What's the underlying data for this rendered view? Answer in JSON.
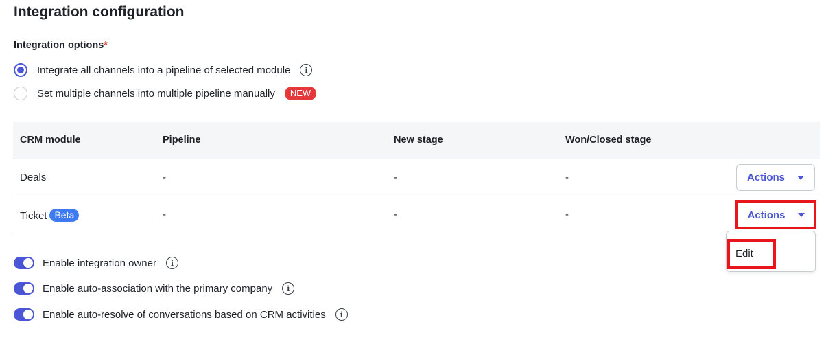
{
  "title": "Integration configuration",
  "options_label": "Integration options",
  "required_mark": "*",
  "radio_options": [
    {
      "label": "Integrate all channels into a pipeline of selected module",
      "checked": true
    },
    {
      "label": "Set multiple channels into multiple pipeline manually",
      "checked": false,
      "badge": "NEW"
    }
  ],
  "table": {
    "headers": [
      "CRM module",
      "Pipeline",
      "New stage",
      "Won/Closed stage"
    ],
    "rows": [
      {
        "module": "Deals",
        "badge": "",
        "pipeline": "-",
        "new_stage": "-",
        "won_stage": "-",
        "action": "Actions"
      },
      {
        "module": "Ticket",
        "badge": "Beta",
        "pipeline": "-",
        "new_stage": "-",
        "won_stage": "-",
        "action": "Actions"
      }
    ]
  },
  "dropdown": {
    "items": [
      "Edit"
    ]
  },
  "toggles": [
    {
      "label": "Enable integration owner",
      "on": true
    },
    {
      "label": "Enable auto-association with the primary company",
      "on": true
    },
    {
      "label": "Enable auto-resolve of conversations based on CRM activities",
      "on": true
    }
  ],
  "colors": {
    "accent": "#4a56d6",
    "danger": "#e5383b",
    "beta": "#3e7bf2",
    "highlight": "#e8161c"
  },
  "icons": {
    "info": "info-icon",
    "caret": "caret-down-icon"
  }
}
